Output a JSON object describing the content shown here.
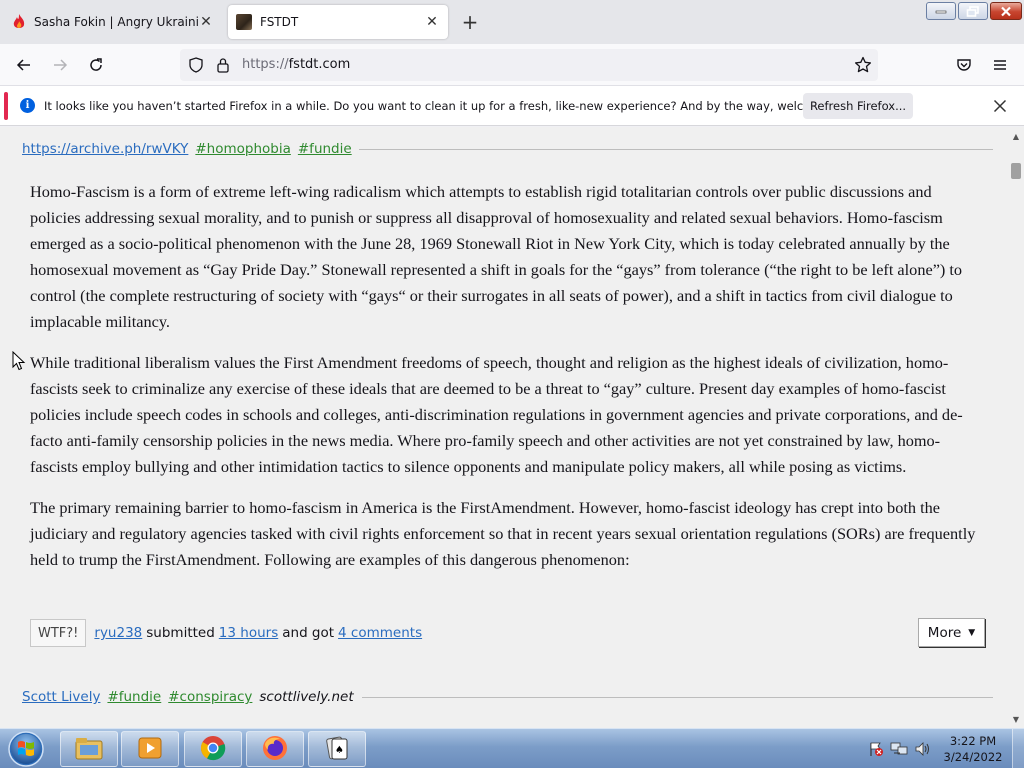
{
  "browser": {
    "tabs": [
      {
        "title": "Sasha Fokin | Angry Ukrainian K...",
        "active": false
      },
      {
        "title": "FSTDT",
        "active": true
      }
    ],
    "url_scheme": "https://",
    "url_host": "fstdt.com"
  },
  "notification": {
    "message": "It looks like you haven’t started Firefox in a while. Do you want to clean it up for a fresh, like-new experience? And by the way, welcome back!",
    "button": "Refresh Firefox..."
  },
  "post": {
    "source_link": "https://archive.ph/rwVKY",
    "tags": [
      "#homophobia",
      "#fundie"
    ],
    "paragraphs": [
      "Homo-Fascism is a form of extreme left-wing radicalism which attempts to establish rigid totalitarian controls over public discussions and policies addressing sexual morality, and to punish or suppress all disapproval of homosexuality and related sexual behaviors. Homo-fascism emerged as a socio-political phenomenon with the June 28, 1969 Stonewall Riot in New York City, which is today celebrated annually by the homosexual movement as “Gay Pride Day.” Stonewall represented a shift in goals for the “gays” from tolerance (“the right to be left alone”) to control (the complete restructuring of society with “gays“ or their surrogates in all seats of power), and a shift in tactics from civil dialogue to implacable militancy.",
      "While traditional liberalism values the First Amendment freedoms of speech, thought and religion as the highest ideals of civilization, homo-fascists seek to criminalize any exercise of these ideals that are deemed to be a threat to “gay” culture. Present day examples of homo-fascist policies include speech codes in schools and colleges, anti-discrimination regulations in government agencies and private corporations, and de-facto anti-family censorship policies in the news media. Where pro-family speech and other activities are not yet constrained by law, homo-fascists employ bullying and other intimidation tactics to silence opponents and manipulate policy makers, all while posing as victims.",
      "The primary remaining barrier to homo-fascism in America is the FirstAmendment. However, homo-fascist ideology has crept into both the judiciary and regulatory agencies tasked with civil rights enforcement so that in recent years sexual orientation regulations (SORs) are frequently held to trump the FirstAmendment. Following are examples of this dangerous phenomenon:"
    ],
    "reaction_button": "WTF?!",
    "submitter": "ryu238",
    "submitted_text": "submitted",
    "time_ago": "13 hours",
    "and_got_text": "and got",
    "comments": "4 comments",
    "more_button": "More"
  },
  "next_post": {
    "author": "Scott Lively",
    "tags": [
      "#fundie",
      "#conspiracy"
    ],
    "site": "scottlively.net"
  },
  "taskbar": {
    "time": "3:22 PM",
    "date": "3/24/2022"
  },
  "colors": {
    "link_blue": "#2a6cbf",
    "tag_green": "#2f8a2f",
    "notification_accent": "#e22850",
    "info_blue": "#0060df"
  },
  "icons": [
    "firefox-flame-icon",
    "back-icon",
    "forward-icon",
    "reload-icon",
    "shield-icon",
    "lock-icon",
    "bookmark-star-icon",
    "pocket-icon",
    "menu-icon",
    "info-icon",
    "close-icon"
  ]
}
